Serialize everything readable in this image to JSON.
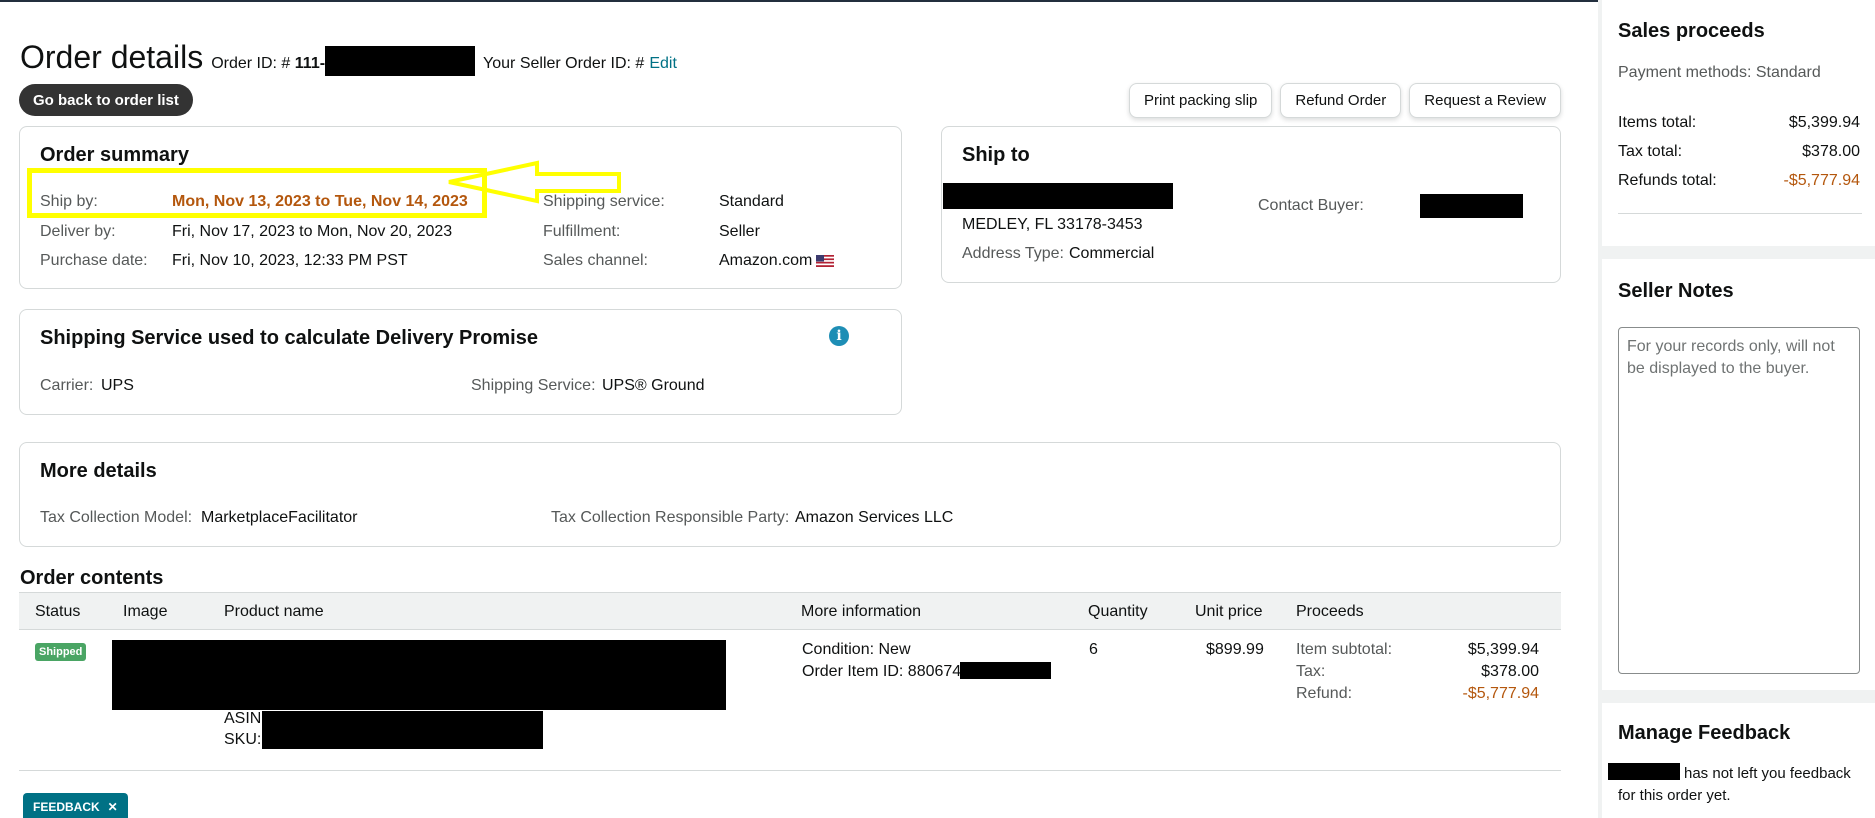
{
  "header": {
    "title": "Order details",
    "order_id_label": "Order ID: #",
    "order_id_value": "111-",
    "seller_order_id_label": "Your Seller Order ID: #",
    "edit_link": "Edit",
    "back_button": "Go back to order list",
    "actions": [
      "Print packing slip",
      "Refund Order",
      "Request a Review"
    ]
  },
  "order_summary": {
    "title": "Order summary",
    "ship_by_label": "Ship by:",
    "ship_by_value": "Mon, Nov 13, 2023 to Tue, Nov 14, 2023",
    "deliver_by_label": "Deliver by:",
    "deliver_by_value": "Fri, Nov 17, 2023 to Mon, Nov 20, 2023",
    "purchase_date_label": "Purchase date:",
    "purchase_date_value": "Fri, Nov 10, 2023, 12:33 PM PST",
    "shipping_service_label": "Shipping service:",
    "shipping_service_value": "Standard",
    "fulfillment_label": "Fulfillment:",
    "fulfillment_value": "Seller",
    "sales_channel_label": "Sales channel:",
    "sales_channel_value": "Amazon.com",
    "highlight_color": "#ffff00"
  },
  "ship_to": {
    "title": "Ship to",
    "city_line": "MEDLEY, FL 33178-3453",
    "address_type_label": "Address Type:",
    "address_type_value": "Commercial",
    "contact_buyer_label": "Contact Buyer:"
  },
  "shipping_service_card": {
    "title": "Shipping Service used to calculate Delivery Promise",
    "carrier_label": "Carrier:",
    "carrier_value": "UPS",
    "service_label": "Shipping Service:",
    "service_value": "UPS® Ground",
    "info_icon": "i"
  },
  "more_details": {
    "title": "More details",
    "tax_model_label": "Tax Collection Model:",
    "tax_model_value": "MarketplaceFacilitator",
    "tax_party_label": "Tax Collection Responsible Party:",
    "tax_party_value": "Amazon Services LLC"
  },
  "order_contents": {
    "title": "Order contents",
    "columns": [
      "Status",
      "Image",
      "Product name",
      "More information",
      "Quantity",
      "Unit price",
      "Proceeds"
    ],
    "row": {
      "status": "Shipped",
      "asin_label": "ASIN:",
      "sku_label": "SKU:",
      "condition": "Condition: New",
      "order_item_id": "Order Item ID: 880674",
      "quantity": "6",
      "unit_price": "$899.99",
      "item_subtotal_label": "Item subtotal:",
      "item_subtotal_value": "$5,399.94",
      "tax_label": "Tax:",
      "tax_value": "$378.00",
      "refund_label": "Refund:",
      "refund_value": "-$5,777.94"
    }
  },
  "feedback_tab": {
    "label": "FEEDBACK",
    "close": "✕"
  },
  "sales_proceeds": {
    "title": "Sales proceeds",
    "payment_methods": "Payment methods: Standard",
    "items_total_label": "Items total:",
    "items_total_value": "$5,399.94",
    "tax_total_label": "Tax total:",
    "tax_total_value": "$378.00",
    "refunds_total_label": "Refunds total:",
    "refunds_total_value": "-$5,777.94"
  },
  "seller_notes": {
    "title": "Seller Notes",
    "placeholder": "For your records only, will not be displayed to the buyer."
  },
  "manage_feedback": {
    "title": "Manage Feedback",
    "text_part1": "has not left you feedback",
    "text_part2": "for this order yet."
  },
  "colors": {
    "accent_link": "#007185",
    "warning_orange": "#b4570d",
    "shipped_badge": "#4aa564",
    "info_icon": "#1e8eb5"
  }
}
